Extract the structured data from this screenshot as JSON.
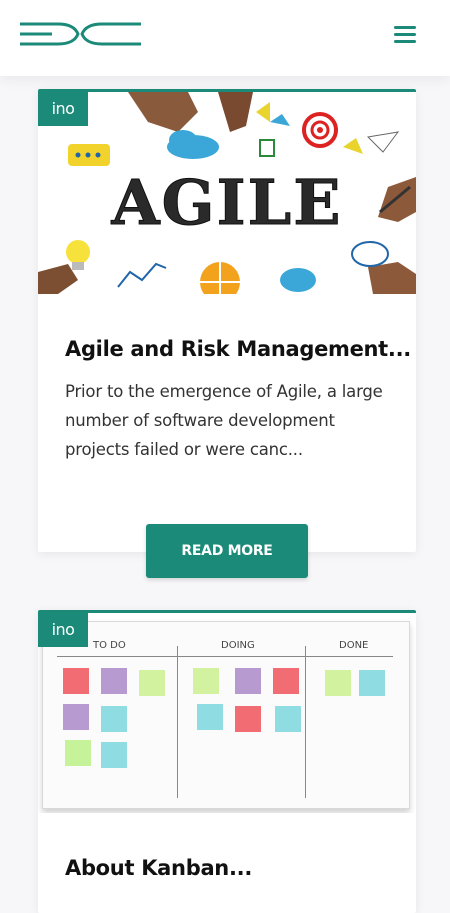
{
  "header": {
    "logo_icon": "dc-logo",
    "menu_icon": "hamburger-menu-icon",
    "brand_color": "#1b8a78"
  },
  "cards": [
    {
      "badge": "ino",
      "image_word": "AGILE",
      "title": "Agile and Risk Management...",
      "excerpt": "Prior to the emergence of Agile, a large number of software development projects failed or were canc...",
      "button": "READ MORE"
    },
    {
      "badge": "ino",
      "board_columns": [
        "TO DO",
        "DOING",
        "DONE"
      ],
      "title": "About Kanban..."
    }
  ]
}
